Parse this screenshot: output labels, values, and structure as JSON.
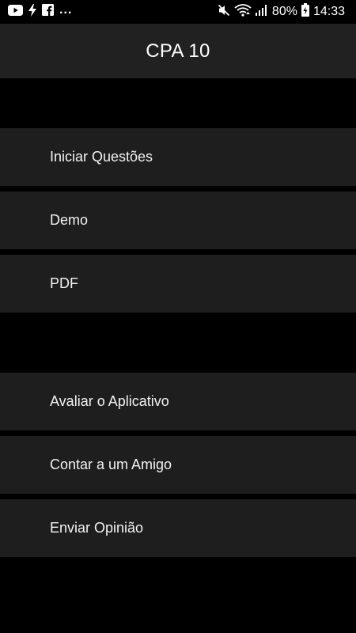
{
  "status_bar": {
    "overflow_dots": "...",
    "battery_percent": "80%",
    "time": "14:33",
    "icons_left": [
      "youtube-icon",
      "flash-icon",
      "facebook-icon"
    ],
    "icons_right": [
      "mute-icon",
      "wifi-icon",
      "signal-icon",
      "battery-icon"
    ]
  },
  "app_bar": {
    "title": "CPA 10"
  },
  "menu": {
    "items": [
      {
        "label": "Iniciar Questões"
      },
      {
        "label": "Demo"
      },
      {
        "label": "PDF"
      },
      {
        "label": "Avaliar o Aplicativo"
      },
      {
        "label": "Contar a um Amigo"
      },
      {
        "label": "Enviar Opinião"
      }
    ]
  },
  "colors": {
    "background": "#000000",
    "app_bar": "#212121",
    "item_background": "#1e1e1e",
    "text": "#ffffff"
  }
}
